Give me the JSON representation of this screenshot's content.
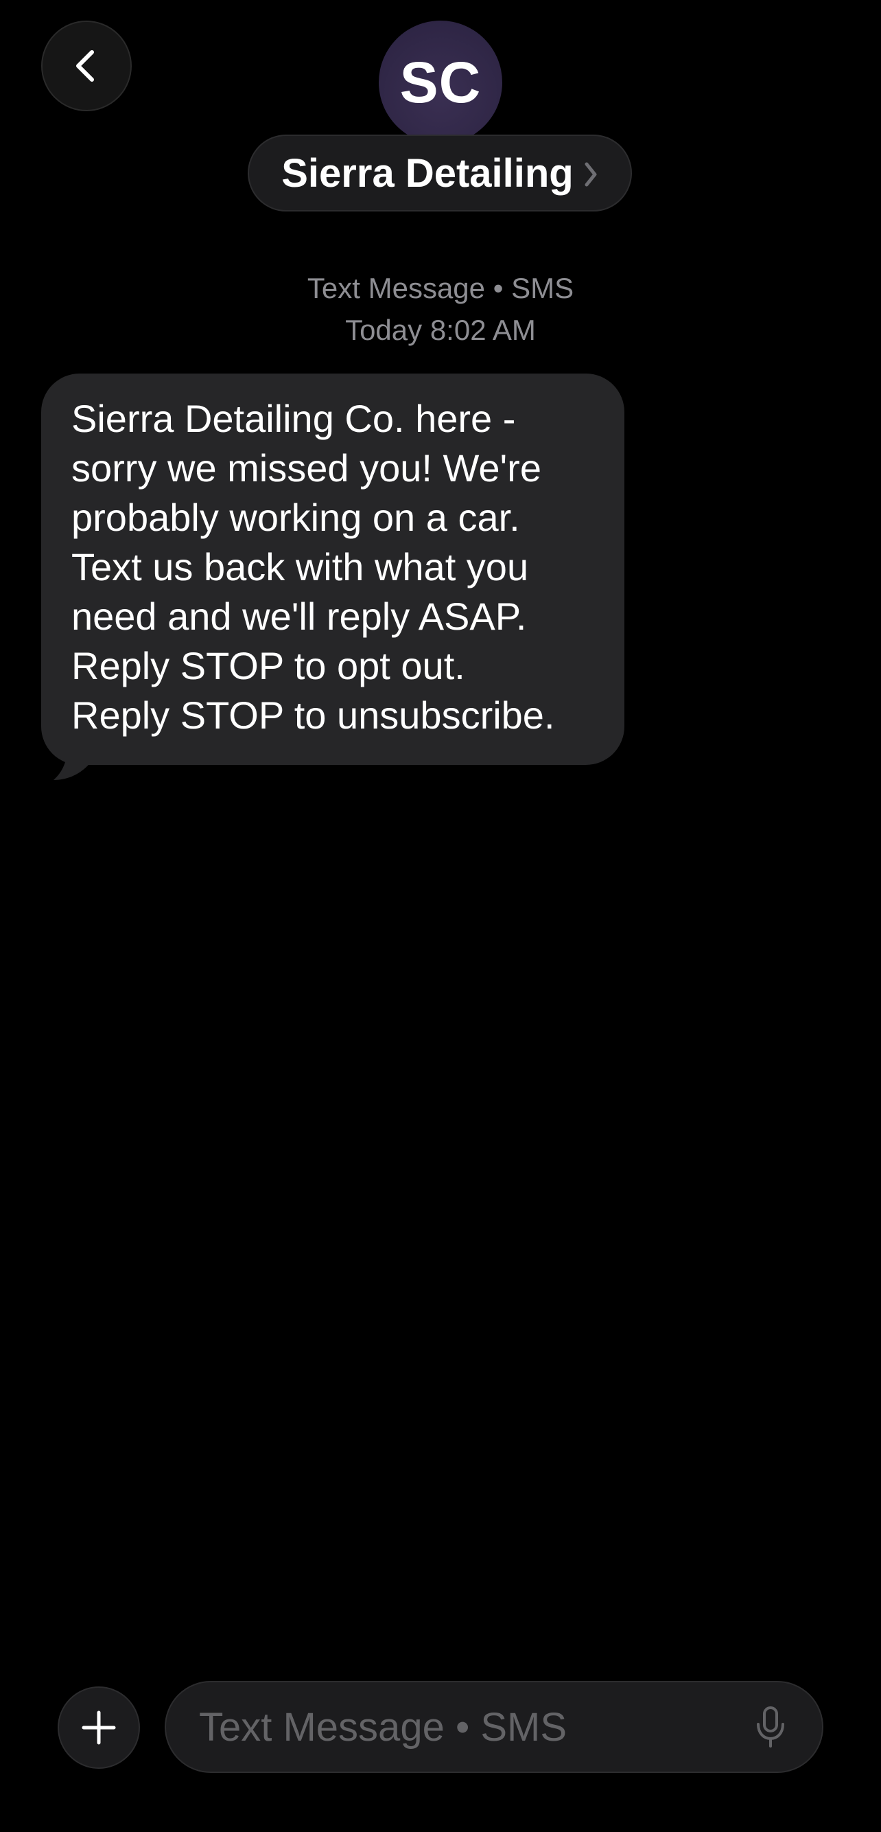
{
  "header": {
    "avatar_initials": "SC",
    "contact_name": "Sierra Detailing",
    "back_icon": "chevron-left-icon",
    "contact_chevron_icon": "chevron-right-icon"
  },
  "conversation": {
    "service_label": "Text Message • SMS",
    "date_label": "Today",
    "time_label": "8:02 AM",
    "messages": [
      {
        "direction": "incoming",
        "lines": [
          "Sierra Detailing Co. here -",
          "sorry we missed you! We're",
          "probably working on a car.",
          "Text us back with what you",
          "need and we'll reply ASAP.",
          "Reply STOP to opt out.",
          "Reply STOP to unsubscribe."
        ]
      }
    ]
  },
  "composer": {
    "placeholder": "Text Message • SMS",
    "value": "",
    "plus_icon": "plus-icon",
    "mic_icon": "microphone-icon"
  },
  "colors": {
    "background": "#000000",
    "bubble_incoming": "#262628",
    "secondary_text": "#8e8e93",
    "control_background": "#1c1c1e",
    "avatar": "#2f2648"
  }
}
